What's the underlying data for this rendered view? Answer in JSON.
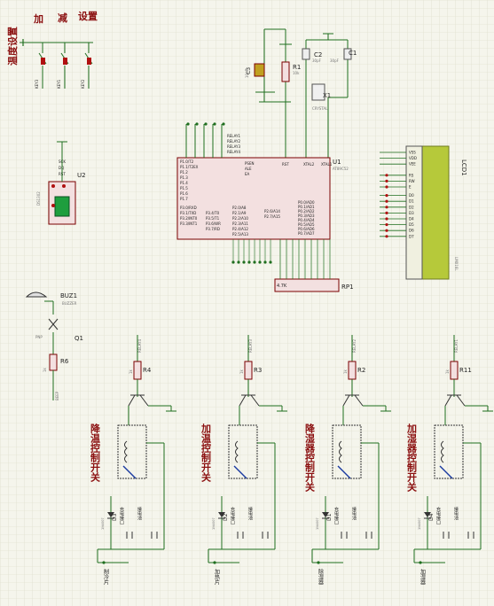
{
  "colors": {
    "background": "#f5f5ec",
    "grid": "#d9d9c6",
    "wire": "#1e6e1e",
    "ic_fill": "#f3e0e0",
    "ic_stroke": "#7a0000",
    "lcd_fill": "#b6c93a",
    "label_red": "#8b1010",
    "label_blue": "#1a1a8c"
  },
  "buttons": {
    "labels_top": [
      "设置",
      "减",
      "加"
    ],
    "title": "温度设置",
    "refs": [
      "KEY3",
      "KEY1",
      "KEY2"
    ]
  },
  "osc": {
    "c3_ref": "C3",
    "c3_val": "10uF",
    "r1_ref": "R1",
    "r1_val": "10k",
    "c2_ref": "C2",
    "c2_val": "30pF",
    "c1_ref": "C1",
    "c1_val": "30pF",
    "x1_ref": "X1",
    "x1_val": "CRYSTAL"
  },
  "mcu": {
    "ref": "U1",
    "part": "AT89C52",
    "left_pins": [
      "P1.0/T2",
      "P1.1/T2EX",
      "P1.2",
      "P1.3",
      "P1.4",
      "P1.5",
      "P1.6",
      "P1.7"
    ],
    "right_pins": [
      "P0.0/AD0",
      "P0.1/AD1",
      "P0.2/AD2",
      "P0.3/AD3",
      "P0.4/AD4",
      "P0.5/AD5",
      "P0.6/AD6",
      "P0.7/AD7"
    ],
    "top_pins": [
      "RST",
      "XTAL2",
      "XTAL1"
    ],
    "ctrl_pins": [
      "PSEN",
      "ALE",
      "EA"
    ],
    "p2_pins": [
      "P2.0/A8",
      "P2.1/A9",
      "P2.2/A10",
      "P2.3/A11",
      "P2.4/A12",
      "P2.5/A13",
      "P2.6/A14",
      "P2.7/A15"
    ],
    "p3_pins": [
      "P3.0/RXD",
      "P3.1/TXD",
      "P3.2/INT0",
      "P3.3/INT1",
      "P3.4/T0",
      "P3.5/T1",
      "P3.6/WR",
      "P3.7/RD"
    ],
    "net_labels": [
      "RELAY1",
      "RELAY2",
      "RELAY3",
      "RELAY4"
    ]
  },
  "ds1302": {
    "ref": "U2",
    "part": "DS1302",
    "pins": [
      "SCK",
      "DQ",
      "RST"
    ]
  },
  "lcd": {
    "ref": "LCD1",
    "part": "LM016L",
    "pins": [
      "VSS",
      "VDD",
      "VEE",
      "RS",
      "RW",
      "E",
      "D0",
      "D1",
      "D2",
      "D3",
      "D4",
      "D5",
      "D6",
      "D7"
    ]
  },
  "rp1": {
    "ref": "RP1",
    "val": "4.7K"
  },
  "buzzer": {
    "ref": "BUZ1",
    "part": "BUZZER",
    "q_ref": "Q1",
    "q_part": "PNP",
    "r_ref": "R6",
    "r_val": "1k",
    "net": "BEEP"
  },
  "relays": [
    {
      "r_ref": "R4",
      "r_val": "1k",
      "net": "RELAY4",
      "title": "降温控制开关",
      "d_ref": "D3",
      "d_part": "1N4007",
      "jack": "充电接口",
      "battery": "接电池",
      "load": "制冷片"
    },
    {
      "r_ref": "R3",
      "r_val": "1k",
      "net": "RELAY3",
      "title": "加温控制开关",
      "d_ref": "D2",
      "d_part": "1N4007",
      "jack": "充电接口",
      "battery": "接电池",
      "load": "加热片"
    },
    {
      "r_ref": "R2",
      "r_val": "1k",
      "net": "RELAY2",
      "title": "降湿器控制开关",
      "d_ref": "D1",
      "d_part": "1N4007",
      "jack": "充电接口",
      "battery": "接电池",
      "load": "除湿器"
    },
    {
      "r_ref": "R11",
      "r_val": "1k",
      "net": "RELAY1",
      "title": "加湿器控制开关",
      "d_ref": "D4",
      "d_part": "1N4007",
      "jack": "充电接口",
      "battery": "接电池",
      "load": "加湿器"
    }
  ]
}
